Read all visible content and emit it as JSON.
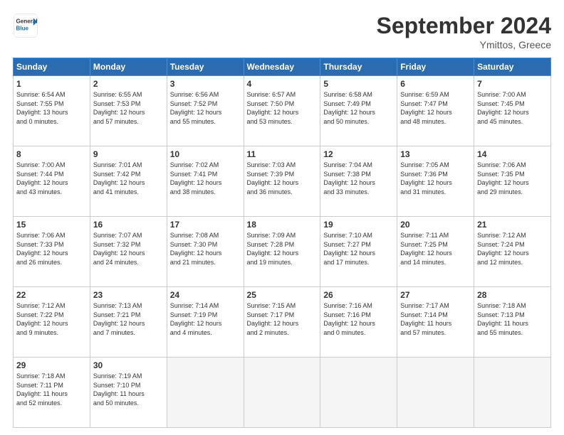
{
  "logo": {
    "line1": "General",
    "line2": "Blue"
  },
  "title": "September 2024",
  "subtitle": "Ymittos, Greece",
  "days_header": [
    "Sunday",
    "Monday",
    "Tuesday",
    "Wednesday",
    "Thursday",
    "Friday",
    "Saturday"
  ],
  "weeks": [
    [
      {
        "num": "1",
        "text": "Sunrise: 6:54 AM\nSunset: 7:55 PM\nDaylight: 13 hours\nand 0 minutes."
      },
      {
        "num": "2",
        "text": "Sunrise: 6:55 AM\nSunset: 7:53 PM\nDaylight: 12 hours\nand 57 minutes."
      },
      {
        "num": "3",
        "text": "Sunrise: 6:56 AM\nSunset: 7:52 PM\nDaylight: 12 hours\nand 55 minutes."
      },
      {
        "num": "4",
        "text": "Sunrise: 6:57 AM\nSunset: 7:50 PM\nDaylight: 12 hours\nand 53 minutes."
      },
      {
        "num": "5",
        "text": "Sunrise: 6:58 AM\nSunset: 7:49 PM\nDaylight: 12 hours\nand 50 minutes."
      },
      {
        "num": "6",
        "text": "Sunrise: 6:59 AM\nSunset: 7:47 PM\nDaylight: 12 hours\nand 48 minutes."
      },
      {
        "num": "7",
        "text": "Sunrise: 7:00 AM\nSunset: 7:45 PM\nDaylight: 12 hours\nand 45 minutes."
      }
    ],
    [
      {
        "num": "8",
        "text": "Sunrise: 7:00 AM\nSunset: 7:44 PM\nDaylight: 12 hours\nand 43 minutes."
      },
      {
        "num": "9",
        "text": "Sunrise: 7:01 AM\nSunset: 7:42 PM\nDaylight: 12 hours\nand 41 minutes."
      },
      {
        "num": "10",
        "text": "Sunrise: 7:02 AM\nSunset: 7:41 PM\nDaylight: 12 hours\nand 38 minutes."
      },
      {
        "num": "11",
        "text": "Sunrise: 7:03 AM\nSunset: 7:39 PM\nDaylight: 12 hours\nand 36 minutes."
      },
      {
        "num": "12",
        "text": "Sunrise: 7:04 AM\nSunset: 7:38 PM\nDaylight: 12 hours\nand 33 minutes."
      },
      {
        "num": "13",
        "text": "Sunrise: 7:05 AM\nSunset: 7:36 PM\nDaylight: 12 hours\nand 31 minutes."
      },
      {
        "num": "14",
        "text": "Sunrise: 7:06 AM\nSunset: 7:35 PM\nDaylight: 12 hours\nand 29 minutes."
      }
    ],
    [
      {
        "num": "15",
        "text": "Sunrise: 7:06 AM\nSunset: 7:33 PM\nDaylight: 12 hours\nand 26 minutes."
      },
      {
        "num": "16",
        "text": "Sunrise: 7:07 AM\nSunset: 7:32 PM\nDaylight: 12 hours\nand 24 minutes."
      },
      {
        "num": "17",
        "text": "Sunrise: 7:08 AM\nSunset: 7:30 PM\nDaylight: 12 hours\nand 21 minutes."
      },
      {
        "num": "18",
        "text": "Sunrise: 7:09 AM\nSunset: 7:28 PM\nDaylight: 12 hours\nand 19 minutes."
      },
      {
        "num": "19",
        "text": "Sunrise: 7:10 AM\nSunset: 7:27 PM\nDaylight: 12 hours\nand 17 minutes."
      },
      {
        "num": "20",
        "text": "Sunrise: 7:11 AM\nSunset: 7:25 PM\nDaylight: 12 hours\nand 14 minutes."
      },
      {
        "num": "21",
        "text": "Sunrise: 7:12 AM\nSunset: 7:24 PM\nDaylight: 12 hours\nand 12 minutes."
      }
    ],
    [
      {
        "num": "22",
        "text": "Sunrise: 7:12 AM\nSunset: 7:22 PM\nDaylight: 12 hours\nand 9 minutes."
      },
      {
        "num": "23",
        "text": "Sunrise: 7:13 AM\nSunset: 7:21 PM\nDaylight: 12 hours\nand 7 minutes."
      },
      {
        "num": "24",
        "text": "Sunrise: 7:14 AM\nSunset: 7:19 PM\nDaylight: 12 hours\nand 4 minutes."
      },
      {
        "num": "25",
        "text": "Sunrise: 7:15 AM\nSunset: 7:17 PM\nDaylight: 12 hours\nand 2 minutes."
      },
      {
        "num": "26",
        "text": "Sunrise: 7:16 AM\nSunset: 7:16 PM\nDaylight: 12 hours\nand 0 minutes."
      },
      {
        "num": "27",
        "text": "Sunrise: 7:17 AM\nSunset: 7:14 PM\nDaylight: 11 hours\nand 57 minutes."
      },
      {
        "num": "28",
        "text": "Sunrise: 7:18 AM\nSunset: 7:13 PM\nDaylight: 11 hours\nand 55 minutes."
      }
    ],
    [
      {
        "num": "29",
        "text": "Sunrise: 7:18 AM\nSunset: 7:11 PM\nDaylight: 11 hours\nand 52 minutes."
      },
      {
        "num": "30",
        "text": "Sunrise: 7:19 AM\nSunset: 7:10 PM\nDaylight: 11 hours\nand 50 minutes."
      },
      {
        "num": "",
        "text": ""
      },
      {
        "num": "",
        "text": ""
      },
      {
        "num": "",
        "text": ""
      },
      {
        "num": "",
        "text": ""
      },
      {
        "num": "",
        "text": ""
      }
    ]
  ]
}
